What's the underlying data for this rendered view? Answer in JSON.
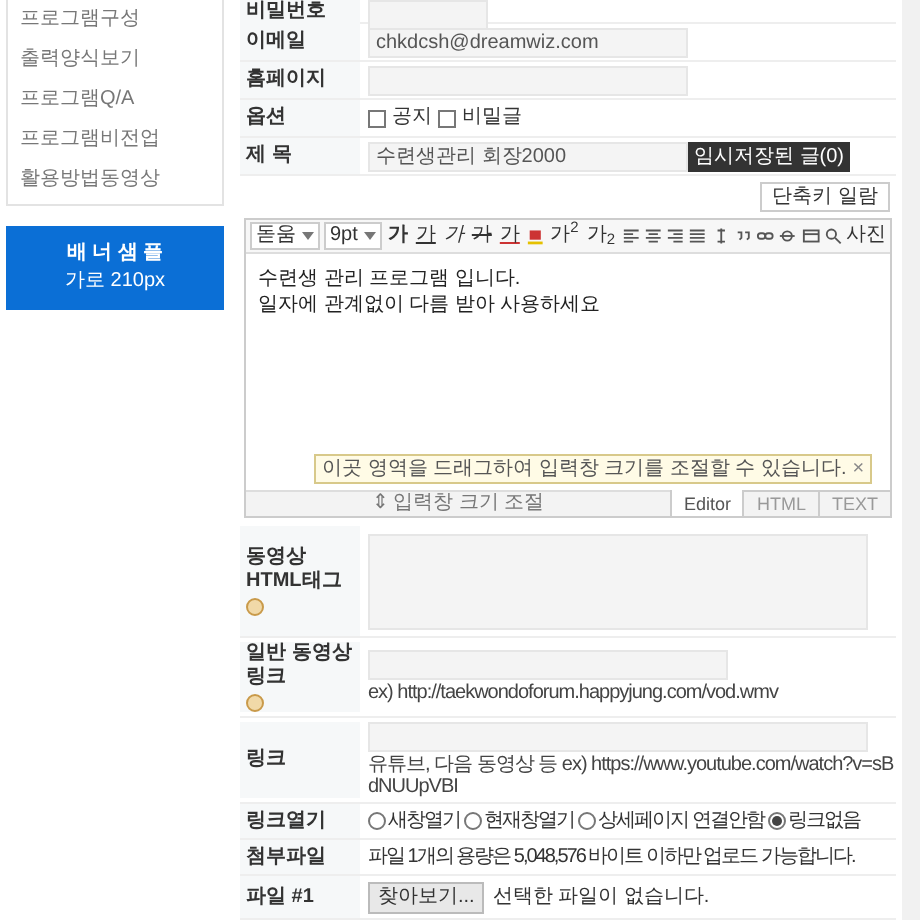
{
  "sidebar": {
    "items": [
      {
        "label": "프로그램구성"
      },
      {
        "label": "출력양식보기"
      },
      {
        "label": "프로그램Q/A"
      },
      {
        "label": "프로그램비전업"
      },
      {
        "label": "활용방법동영상"
      }
    ],
    "banner": {
      "title": "배 너 샘 플",
      "subtitle": "가로 210px"
    }
  },
  "form_top": [
    {
      "kind": "input",
      "label": "비밀번호"
    },
    {
      "kind": "input",
      "label": "이메일",
      "value": "chkdcsh@dreamwiz.com"
    },
    {
      "kind": "input",
      "label": "홈페이지"
    },
    {
      "kind": "options",
      "label": "옵션",
      "options": [
        {
          "label": "공지",
          "checked": false
        },
        {
          "label": "비밀글",
          "checked": false
        }
      ]
    },
    {
      "kind": "subject",
      "label": "제 목",
      "value": "수련생관리 회장2000",
      "button": "임시저장된 글(0)"
    }
  ],
  "shortcut_button": "단축키 일람",
  "editor": {
    "toolbar": [
      {
        "kind": "select",
        "label": "돋움"
      },
      {
        "kind": "select",
        "label": "9pt"
      },
      {
        "kind": "text",
        "label": "가"
      },
      {
        "kind": "text",
        "label": "가"
      },
      {
        "kind": "text",
        "label": "가"
      },
      {
        "kind": "text",
        "label": "가"
      },
      {
        "kind": "text",
        "label": "가"
      },
      {
        "kind": "icon"
      },
      {
        "kind": "text",
        "label": "가$^{2}$"
      },
      {
        "kind": "text",
        "label": "가$_{2}$"
      },
      {
        "kind": "icon"
      },
      {
        "kind": "icon"
      },
      {
        "kind": "icon"
      },
      {
        "kind": "icon"
      },
      {
        "kind": "icon"
      },
      {
        "kind": "icon"
      },
      {
        "kind": "icon"
      },
      {
        "kind": "icon"
      },
      {
        "kind": "icon"
      },
      {
        "kind": "icon"
      },
      {
        "kind": "photo",
        "label": "사진"
      }
    ],
    "body": [
      "수련생 관리 프로그램 입니다.",
      "일자에 관계없이 다름 받아 사용하세요"
    ],
    "tooltip": "이곳 영역을 드래그하여 입력창 크기를 조절할 수 있습니다.",
    "tooltip_close": "×",
    "resize_label": "⇕ 입력창 크기 조절",
    "modes": [
      {
        "label": "Editor",
        "selected": true
      },
      {
        "label": "HTML",
        "selected": false
      },
      {
        "label": "TEXT",
        "selected": false
      }
    ]
  },
  "form_bottom": [
    {
      "kind": "textarea",
      "label": "동영상HTML태그",
      "help": true
    },
    {
      "kind": "input-hint",
      "label": "일반 동영상 링크",
      "help": true,
      "hint": "ex) http://taekwondoforum.happyjung.com/vod.wmv"
    },
    {
      "kind": "input-hint",
      "label": "링크",
      "help": false,
      "hint": "유튜브, 다음 동영상 등 ex) https://www.youtube.com/watch?v=sBdNUUpVBI"
    },
    {
      "kind": "radios",
      "label": "링크열기",
      "options": [
        {
          "label": "새창열기",
          "selected": false
        },
        {
          "label": "현재창열기",
          "selected": false
        },
        {
          "label": "상세페이지 연결안함",
          "selected": false
        },
        {
          "label": "링크없음",
          "selected": true
        }
      ]
    },
    {
      "kind": "note",
      "label": "첨부파일",
      "text": "파일 1개의 용량은 5,048,576 바이트 이하만 업로드 가능합니다."
    },
    {
      "kind": "file",
      "label": "파일 #1",
      "button": "찾아보기...",
      "status": "선택한 파일이 없습니다."
    }
  ]
}
